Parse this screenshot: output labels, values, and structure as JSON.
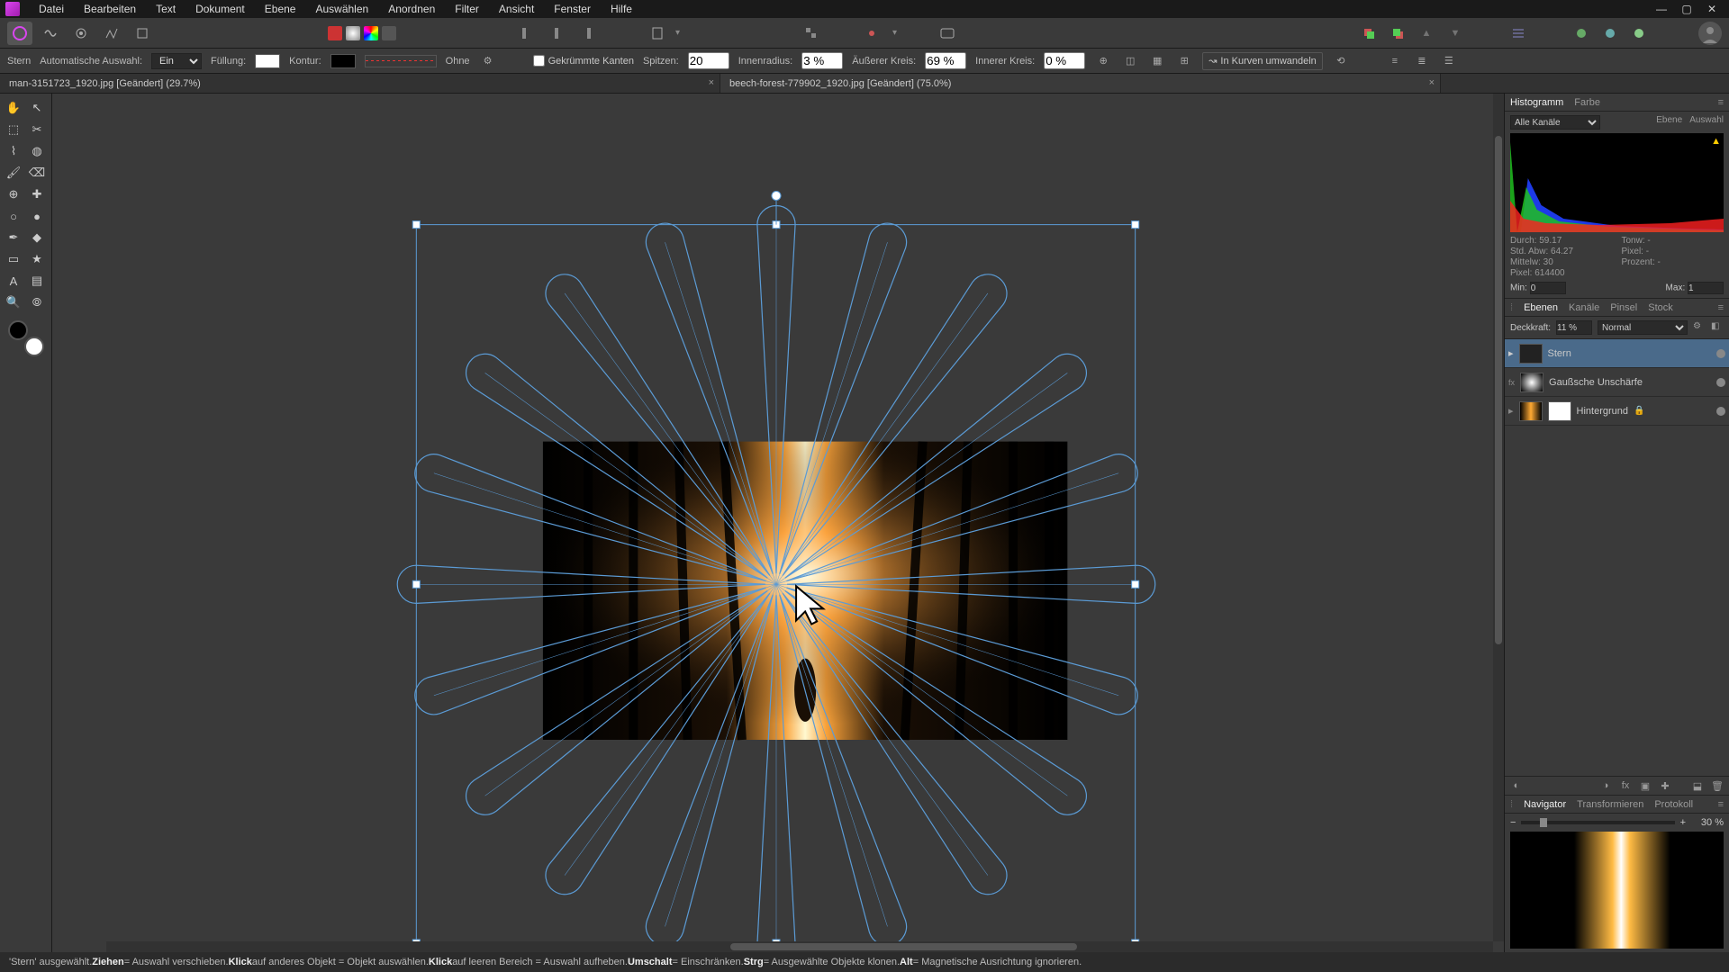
{
  "menu": {
    "items": [
      "Datei",
      "Bearbeiten",
      "Text",
      "Dokument",
      "Ebene",
      "Auswählen",
      "Anordnen",
      "Filter",
      "Ansicht",
      "Fenster",
      "Hilfe"
    ]
  },
  "tabs": [
    {
      "label": "man-3151723_1920.jpg [Geändert] (29.7%)"
    },
    {
      "label": "beech-forest-779902_1920.jpg [Geändert] (75.0%)"
    }
  ],
  "ctx": {
    "tool": "Stern",
    "autosel_label": "Automatische Auswahl:",
    "autosel_value": "Ein",
    "fill_label": "Füllung:",
    "stroke_label": "Kontur:",
    "stroke_style": "Ohne",
    "curved_edges": "Gekrümmte Kanten",
    "points_label": "Spitzen:",
    "points_value": "20",
    "inner_label": "Innenradius:",
    "inner_value": "3 %",
    "outer_label": "Äußerer Kreis:",
    "outer_value": "69 %",
    "innercircle_label": "Innerer Kreis:",
    "innercircle_value": "0 %",
    "convert": "In Kurven umwandeln"
  },
  "panels": {
    "hist_tab": "Histogramm",
    "color_tab": "Farbe",
    "channels": "Alle Kanäle",
    "ebene": "Ebene",
    "auswahl": "Auswahl",
    "stats": {
      "durch": "Durch: 59.17",
      "std": "Std. Abw: 64.27",
      "mittel": "Mittelw: 30",
      "pixel": "Pixel: 614400",
      "tonw": "Tonw: -",
      "pixel2": "Pixel: -",
      "prozent": "Prozent: -"
    },
    "min_label": "Min:",
    "min_val": "0",
    "max_label": "Max:",
    "max_val": "1",
    "layer_tabs": [
      "Ebenen",
      "Kanäle",
      "Pinsel",
      "Stock"
    ],
    "opacity_label": "Deckkraft:",
    "opacity_val": "11 %",
    "blend": "Normal",
    "layers": [
      {
        "name": "Stern",
        "sel": true
      },
      {
        "name": "Gaußsche Unschärfe"
      },
      {
        "name": "Hintergrund",
        "locked": true
      }
    ],
    "nav_tabs": [
      "Navigator",
      "Transformieren",
      "Protokoll"
    ],
    "zoom": "30 %"
  },
  "status": {
    "p1": "'Stern' ausgewählt. ",
    "k1": "Ziehen",
    "t1": " = Auswahl verschieben. ",
    "k2": "Klick",
    "t2": " auf anderes Objekt = Objekt auswählen. ",
    "k3": "Klick",
    "t3": " auf leeren Bereich = Auswahl aufheben. ",
    "k4": "Umschalt",
    "t4": " = Einschränken. ",
    "k5": "Strg",
    "t5": " = Ausgewählte Objekte klonen. ",
    "k6": "Alt",
    "t6": " = Magnetische Ausrichtung ignorieren."
  },
  "chart_data": {
    "type": "histogram",
    "title": "Histogramm",
    "channels": [
      "R",
      "G",
      "B"
    ],
    "note": "RGB histogram with heavy spike near black (value 0) tapering toward highlights; red channel extends furthest into shadows, blue highest peak at low end, green mid. Tone range 0–255.",
    "xlim": [
      0,
      255
    ],
    "ylim": [
      0,
      1
    ],
    "approx_curve_blue": [
      [
        0,
        1.0
      ],
      [
        20,
        0.6
      ],
      [
        50,
        0.25
      ],
      [
        100,
        0.1
      ],
      [
        180,
        0.05
      ],
      [
        255,
        0.02
      ]
    ],
    "approx_curve_green": [
      [
        0,
        0.9
      ],
      [
        25,
        0.5
      ],
      [
        60,
        0.2
      ],
      [
        120,
        0.08
      ],
      [
        200,
        0.04
      ],
      [
        255,
        0.02
      ]
    ],
    "approx_curve_red": [
      [
        0,
        0.3
      ],
      [
        40,
        0.15
      ],
      [
        100,
        0.1
      ],
      [
        180,
        0.08
      ],
      [
        255,
        0.1
      ]
    ]
  }
}
